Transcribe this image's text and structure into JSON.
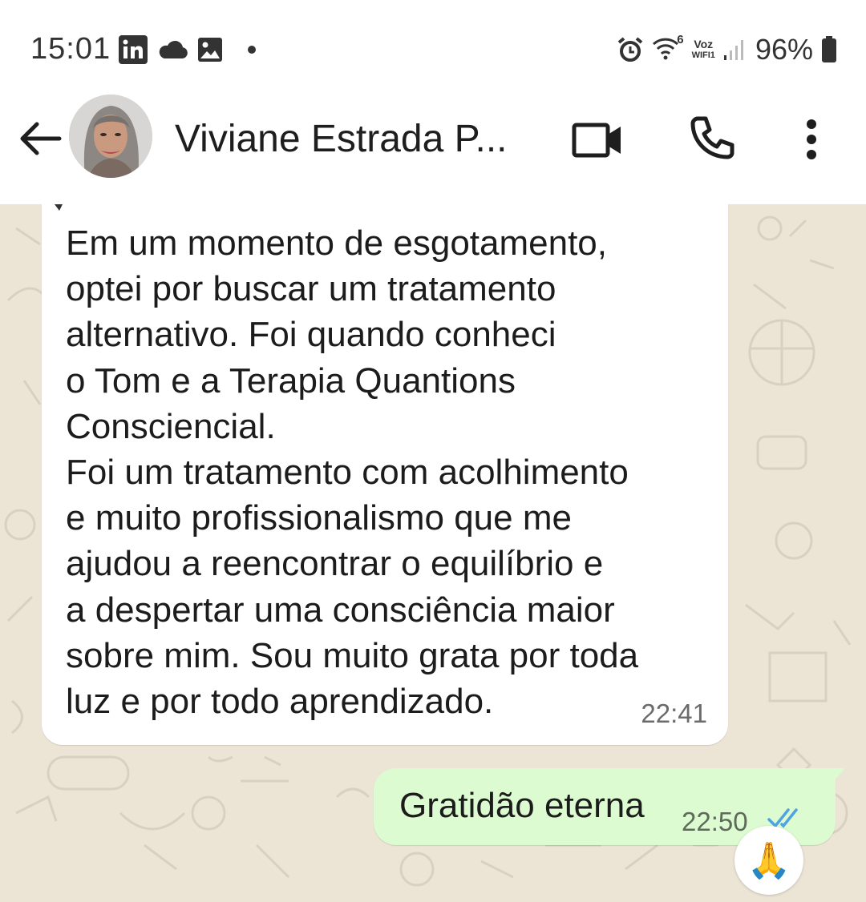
{
  "status_bar": {
    "time": "15:01",
    "battery": "96%",
    "voz_label": "Voz",
    "wifi_label": "WIFI1",
    "wifi_level": "6",
    "left_icons": [
      "linkedin-icon",
      "cloud-icon",
      "image-icon",
      "dot-icon"
    ],
    "right_icons": [
      "alarm-icon",
      "wifi-icon",
      "signal-icon",
      "battery-icon"
    ]
  },
  "header": {
    "contact_name": "Viviane Estrada P...",
    "buttons": [
      "back",
      "video-call",
      "voice-call",
      "more"
    ]
  },
  "messages": [
    {
      "direction": "incoming",
      "text": "Em um momento de esgotamento,\noptei por buscar um tratamento\nalternativo. Foi quando conheci\no Tom e a Terapia Quantions\nConsciencial.\nFoi um tratamento com acolhimento\ne muito profissionalismo que me\najudou a reencontrar o equilíbrio e\na despertar uma consciência maior\nsobre mim. Sou muito grata por toda\nluz e por todo aprendizado.",
      "time": "22:41"
    },
    {
      "direction": "outgoing",
      "text": "Gratidão eterna",
      "time": "22:50",
      "status": "read",
      "reaction": "🙏"
    }
  ],
  "colors": {
    "chat_background": "#ece5d6",
    "outgoing_bubble": "#dcfbd0",
    "incoming_bubble": "#ffffff",
    "read_ticks": "#4fa3e0"
  }
}
